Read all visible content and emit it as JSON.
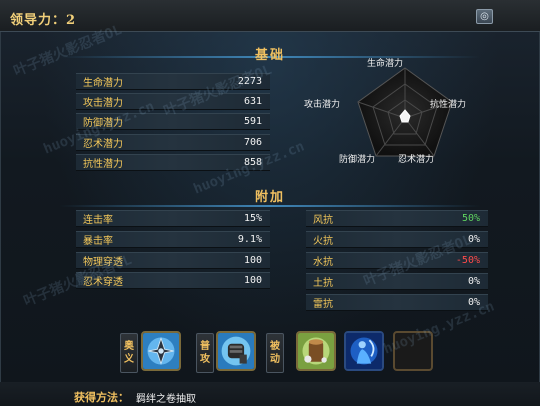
{
  "header": {
    "leader_label": "领导力：2",
    "settings_icon": "swirl-icon"
  },
  "basic": {
    "title": "基础",
    "stats": [
      {
        "label": "生命潜力",
        "value": "2273"
      },
      {
        "label": "攻击潜力",
        "value": "631"
      },
      {
        "label": "防御潜力",
        "value": "591"
      },
      {
        "label": "忍术潜力",
        "value": "706"
      },
      {
        "label": "抗性潜力",
        "value": "858"
      }
    ]
  },
  "radar": {
    "labels": {
      "top": "生命潜力",
      "right": "抗性潜力",
      "bottom_right": "忍术潜力",
      "bottom_left": "防御潜力",
      "left": "攻击潜力"
    }
  },
  "extra": {
    "title": "附加",
    "left": [
      {
        "label": "连击率",
        "value": "15%"
      },
      {
        "label": "暴击率",
        "value": "9.1%"
      },
      {
        "label": "物理穿透",
        "value": "100"
      },
      {
        "label": "忍术穿透",
        "value": "100"
      }
    ],
    "right": [
      {
        "label": "风抗",
        "value": "50%"
      },
      {
        "label": "火抗",
        "value": "0%"
      },
      {
        "label": "水抗",
        "value": "-50%"
      },
      {
        "label": "土抗",
        "value": "0%"
      },
      {
        "label": "雷抗",
        "value": "0%"
      }
    ]
  },
  "skills": {
    "ougi_tag": [
      "奥",
      "义"
    ],
    "normal_tag": [
      "普",
      "攻"
    ],
    "passive_tag": [
      "被",
      "动"
    ],
    "ougi_icon": "shuriken-skill-icon",
    "normal_icon": "fist-skill-icon",
    "passive_icons": [
      "log-substitution-icon",
      "water-clone-icon",
      "empty-slot"
    ]
  },
  "obtain": {
    "label": "获得方法：",
    "value": "羁绊之卷抽取"
  },
  "watermark": {
    "cn": "叶子猪火影忍者OL",
    "en": "huoying.yzz.cn"
  },
  "colors": {
    "gold": "#f0c060",
    "positive": "#5fd35f",
    "negative": "#ff4a4a"
  }
}
